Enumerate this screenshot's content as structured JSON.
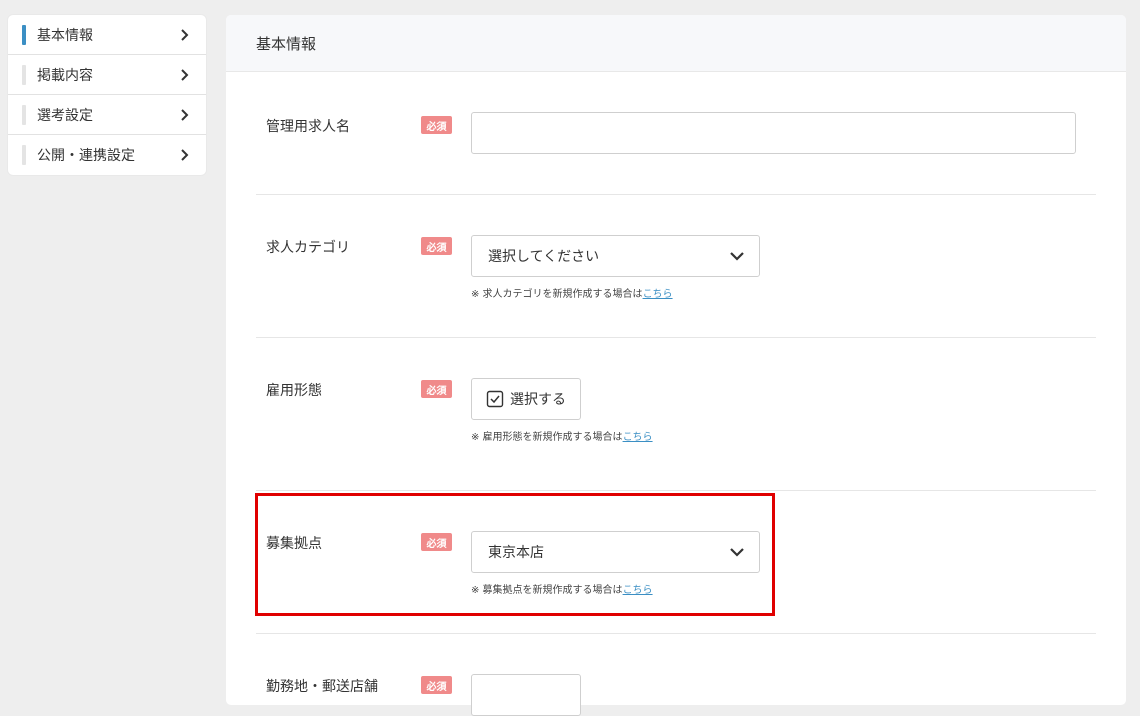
{
  "sidebar": {
    "items": [
      {
        "label": "基本情報",
        "active": true
      },
      {
        "label": "掲載内容",
        "active": false
      },
      {
        "label": "選考設定",
        "active": false
      },
      {
        "label": "公開・連携設定",
        "active": false
      }
    ]
  },
  "main": {
    "title": "基本情報",
    "required_label": "必須",
    "fields": {
      "job_name": {
        "label": "管理用求人名",
        "value": ""
      },
      "job_category": {
        "label": "求人カテゴリ",
        "selected": "選択してください",
        "note_prefix": "※ 求人カテゴリを新規作成する場合は",
        "note_link": "こちら"
      },
      "employment_type": {
        "label": "雇用形態",
        "button_label": "選択する",
        "note_prefix": "※ 雇用形態を新規作成する場合は",
        "note_link": "こちら"
      },
      "recruit_base": {
        "label": "募集拠点",
        "selected": "東京本店",
        "note_prefix": "※ 募集拠点を新規作成する場合は",
        "note_link": "こちら"
      },
      "work_location": {
        "label": "勤務地・郵送店舗"
      }
    }
  },
  "colors": {
    "accent": "#3b8fc4",
    "required_badge": "#f08a8a",
    "highlight": "#e00000"
  }
}
